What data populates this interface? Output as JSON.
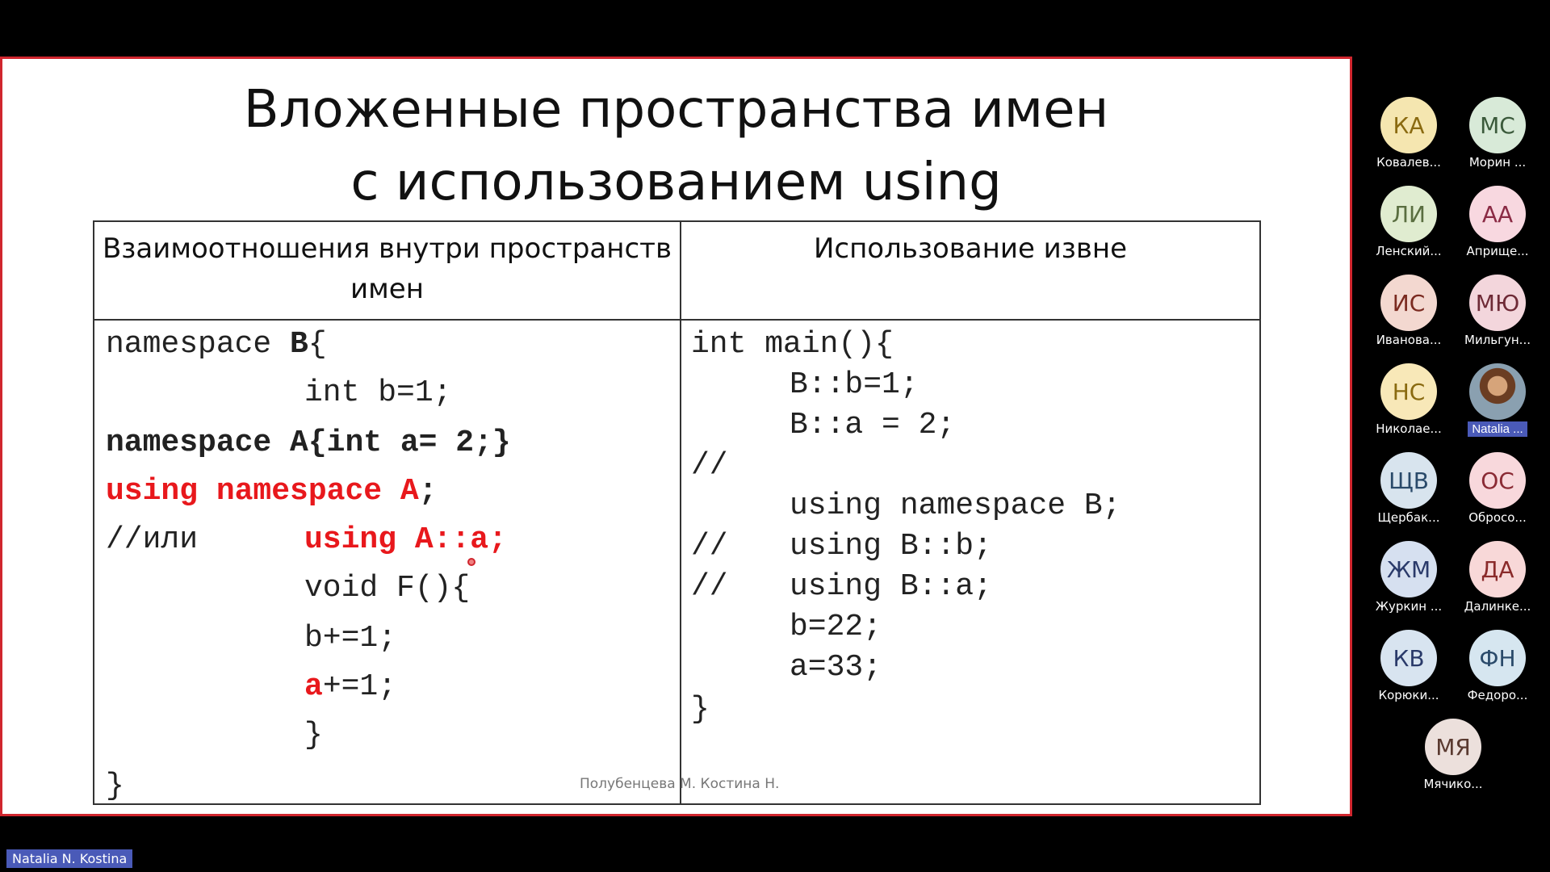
{
  "slide": {
    "title_line1": "Вложенные пространства имен",
    "title_line2": "с использованием  using",
    "left_header": "Взаимоотношения внутри пространств имен",
    "right_header": "Использование извне",
    "left_code": {
      "l1a": "namespace ",
      "l1b": "B",
      "l1c": "{",
      "l2": "int b=1;",
      "l3": "namespace A{int a= 2;}",
      "l4a": "using namespace A",
      "l4b": ";",
      "l5a": "//или",
      "l5b": "using A::a;",
      "l6": "void F(){",
      "l7": "b+=1;",
      "l8a": "a",
      "l8b": "+=1;",
      "l9": "}",
      "l10": "}"
    },
    "right_code": {
      "r1": "int main(){",
      "r2": "B::b=1;",
      "r3": "B::a = 2;",
      "r4": "//",
      "r5": "using namespace B;",
      "r6a": "//",
      "r6b": "using B::b;",
      "r7a": "//",
      "r7b": "using B::a;",
      "r8": "b=22;",
      "r9": "a=33;",
      "r10": "}"
    },
    "footer": "Полубенцева М. Костина Н."
  },
  "participants": [
    {
      "initials": "КА",
      "name": "Ковалев...",
      "bg": "#f5e6b0",
      "fg": "#8a6a10"
    },
    {
      "initials": "МС",
      "name": "Морин ...",
      "bg": "#d8ead8",
      "fg": "#3b5a3b"
    },
    {
      "initials": "ЛИ",
      "name": "Ленский...",
      "bg": "#e0ecd0",
      "fg": "#5a6e40"
    },
    {
      "initials": "АА",
      "name": "Априще...",
      "bg": "#f8d8e0",
      "fg": "#8a2a44"
    },
    {
      "initials": "ИС",
      "name": "Иванова...",
      "bg": "#f3d8d0",
      "fg": "#7a2a20"
    },
    {
      "initials": "МЮ",
      "name": "Мильгун...",
      "bg": "#f3d6dc",
      "fg": "#6e2a36"
    },
    {
      "initials": "НС",
      "name": "Николае...",
      "bg": "#f8e8b8",
      "fg": "#8a6a10"
    },
    {
      "initials": "",
      "name": "Natalia ...",
      "bg": "",
      "fg": ""
    },
    {
      "initials": "ЩВ",
      "name": "Щербак...",
      "bg": "#d8e4ee",
      "fg": "#2a4a6a"
    },
    {
      "initials": "ОС",
      "name": "Обросо...",
      "bg": "#f8d8dc",
      "fg": "#8a2a34"
    },
    {
      "initials": "ЖМ",
      "name": "Журкин ...",
      "bg": "#d6e0f0",
      "fg": "#2a3a6a"
    },
    {
      "initials": "ДА",
      "name": "Далинке...",
      "bg": "#f8d8d8",
      "fg": "#8a2a2a"
    },
    {
      "initials": "КВ",
      "name": "Корюки...",
      "bg": "#d8e4f0",
      "fg": "#2a3a6a"
    },
    {
      "initials": "ФН",
      "name": "Федоро...",
      "bg": "#d6e6f0",
      "fg": "#2a4a6a"
    },
    {
      "initials": "МЯ",
      "name": "Мячико...",
      "bg": "#ece0dc",
      "fg": "#5a3a30"
    }
  ],
  "presenter_name": "Natalia N. Kostina",
  "colors": {
    "frame": "#d0262e",
    "code_red": "#e8181c",
    "name_tag": "#4a5ab8"
  }
}
